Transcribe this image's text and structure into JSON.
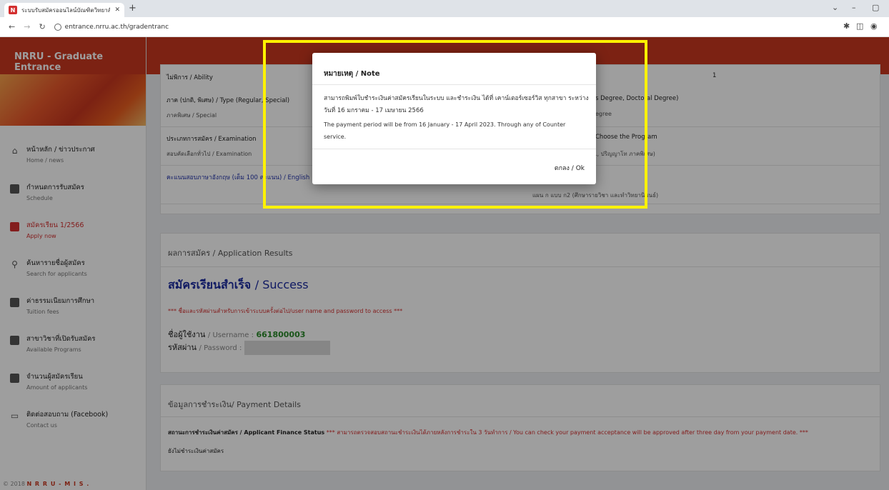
{
  "browser": {
    "tab_title": "ระบบรับสมัครออนไลน์บัณฑิตวิทยาลัย",
    "favicon": "N",
    "url": "entrance.nrru.ac.th/gradentranc"
  },
  "sidebar": {
    "brand": "NRRU - Graduate Entrance",
    "items": [
      {
        "label": "หน้าหลัก / ข่าวประกาศ",
        "sub": "Home / news",
        "icon": "home-icon"
      },
      {
        "label": "กำหนดการรับสมัคร",
        "sub": "Schedule",
        "icon": "calendar-icon"
      },
      {
        "label": "สมัครเรียน 1/2566",
        "sub": "Apply now",
        "icon": "form-icon"
      },
      {
        "label": "ค้นหารายชื่อผู้สมัคร",
        "sub": "Search for applicants",
        "icon": "search-icon"
      },
      {
        "label": "ค่าธรรมเนียมการศึกษา",
        "sub": "Tuition fees",
        "icon": "fees-icon"
      },
      {
        "label": "สาขาวิชาที่เปิดรับสมัคร",
        "sub": "Available Programs",
        "icon": "programs-icon"
      },
      {
        "label": "จำนวนผู้สมัครเรียน",
        "sub": "Amount of applicants",
        "icon": "chart-icon"
      },
      {
        "label": "ติดต่อสอบถาม (Facebook)",
        "sub": "Contact us",
        "icon": "chat-icon"
      }
    ],
    "footer_year": "© 2018",
    "footer_brand": "N R R U - M I S ."
  },
  "card1": {
    "ability": "ไม่พิการ / Ability",
    "ability_value": "1",
    "type_label": "ภาค (ปกติ, พิเศษ) / Type (Regular, Special)",
    "type_value": "ภาคพิเศษ / Special",
    "degree_label": "s Degree, Doctoral Degree)",
    "degree_value": "egree",
    "exam_label": "ประเภทการสมัคร / Examination",
    "exam_value": "สอบคัดเลือกทั่วไป / Examination",
    "program_label": "Choose the Program",
    "program_value": "., ปริญญาโท ภาคพิเศษ)",
    "english_label": "คะแนนสอบภาษาอังกฤษ (เต็ม 100 คะแนน) / English",
    "plan_value": "แผน ก แบบ ก2 (ศึกษารายวิชา และทำวิทยานิพนธ์)"
  },
  "card2": {
    "head": "ผลการสมัคร / Application Results",
    "success_th": "สมัครเรียนสำเร็จ",
    "success_en": "/ Success",
    "warning": "*** ชื่อและรหัสผ่านสำหรับการเข้าระบบครั้งต่อไป/user name and password to access ***",
    "username_th": "ชื่อผู้ใช้งาน",
    "username_en": "/ Username :",
    "username_value": "661800003",
    "password_th": "รหัสผ่าน",
    "password_en": "/ Password :"
  },
  "card3": {
    "head": "ข้อมูลการชำระเงิน/ Payment Details",
    "status_label": "สถานะการชำระเงินค่าสมัคร / Applicant Finance Status",
    "status_note": "*** สามารถตรวจสอบสถานะชำระเงินได้ภายหลังการชำระใน 3 วันทำการ / You can check your payment acceptance will be approved after three day from your payment date. ***",
    "status_value": "ยังไม่ชำระเงินค่าสมัคร"
  },
  "modal": {
    "title": "หมายเหตุ / Note",
    "body_th": "สามารถพิมพ์ใบชำระเงินค่าสมัครเรียนในระบบ และชำระเงิน ได้ที่ เคาน์เตอร์เซอร์วิส ทุกสาขา ระหว่างวันที่ 16 มกราคม - 17 เมษายน 2566",
    "body_en": "The payment period will be from 16 January - 17 April 2023. Through any of Counter service.",
    "ok_label": "ตกลง / Ok"
  },
  "colors": {
    "brand": "#c8371f",
    "highlight": "#fff200",
    "success": "#1b2aa0"
  }
}
